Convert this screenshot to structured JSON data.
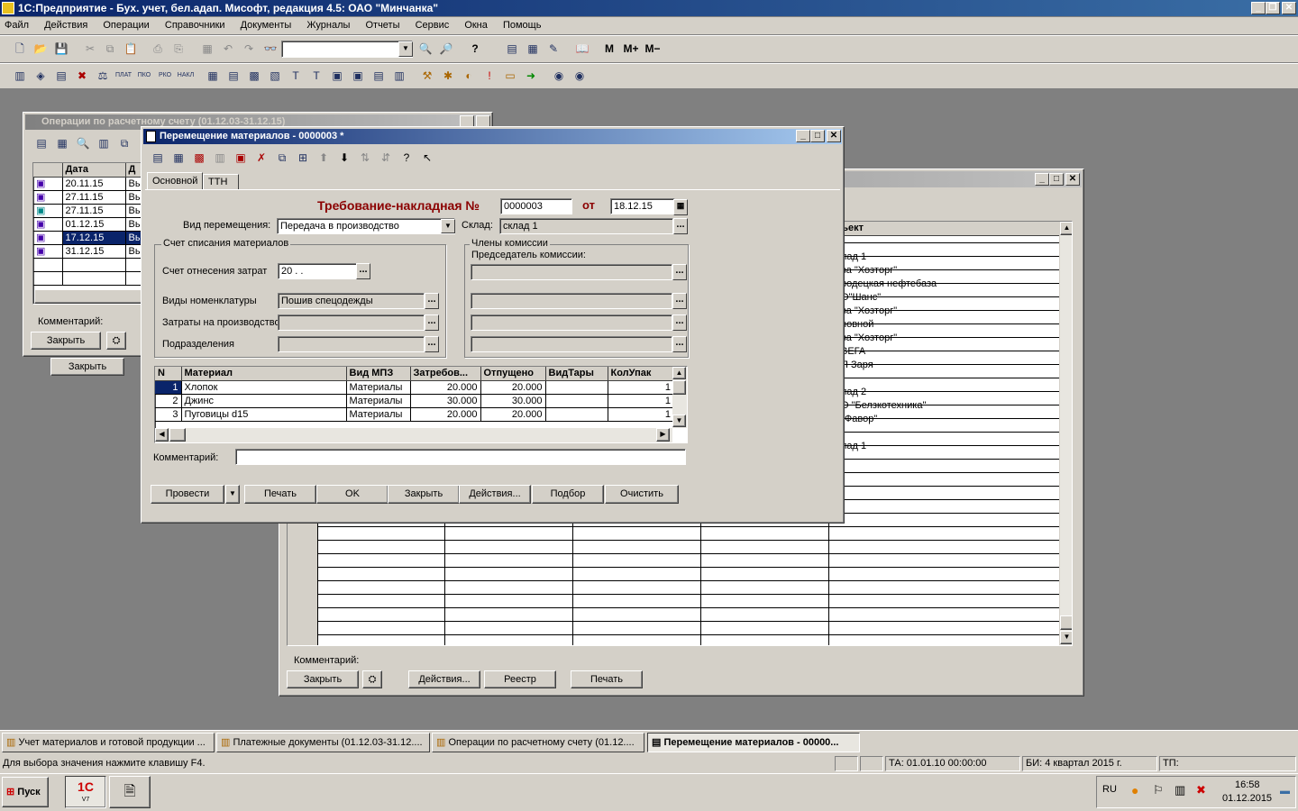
{
  "app": {
    "title": "1С:Предприятие - Бух. учет, бел.адап. Мисофт, редакция 4.5: ОАО \"Минчанка\""
  },
  "menu": [
    "Файл",
    "Действия",
    "Операции",
    "Справочники",
    "Документы",
    "Журналы",
    "Отчеты",
    "Сервис",
    "Окна",
    "Помощь"
  ],
  "toolbar": {
    "m": "M",
    "mplus": "M+",
    "mminus": "M−",
    "plat": "ПЛАТ",
    "pko": "ПКО",
    "rko": "РКО",
    "nakl": "НАКЛ"
  },
  "back_window": {
    "title": "Операции по расчетному счету (01.12.03-31.12.15)",
    "headers": [
      "",
      "Дата",
      "Д"
    ],
    "rows": [
      [
        "20.11.15",
        "Вы"
      ],
      [
        "27.11.15",
        "Вы"
      ],
      [
        "27.11.15",
        "Вы"
      ],
      [
        "01.12.15",
        "Вы"
      ],
      [
        "17.12.15",
        "Вы"
      ],
      [
        "31.12.15",
        "Вы"
      ]
    ],
    "comment_label": "Комментарий:",
    "close": "Закрыть",
    "close2": "Закрыть"
  },
  "right_window": {
    "col_header": "ъект",
    "objects": [
      "",
      "лад 1",
      "ва \"Хозторг\"",
      "родецкая нефтебаза",
      "О\"Шанс\"",
      "ва \"Хозторг\"",
      "новной",
      "ва \"Хозторг\"",
      "ВЕГА",
      "П Заря",
      "",
      "лад 2",
      "О \"Белзкотехника\"",
      "\"Фавор\"",
      "",
      "лад 1"
    ],
    "comment_label": "Комментарий:",
    "close": "Закрыть",
    "actions": "Действия...",
    "registry": "Реестр",
    "print": "Печать"
  },
  "dialog": {
    "title": "Перемещение материалов - 0000003 *",
    "tabs": [
      "Основной",
      "ТТН"
    ],
    "heading": "Требование-накладная №",
    "doc_number": "0000003",
    "from": "от",
    "date": "18.12.15",
    "move_type_label": "Вид перемещения:",
    "move_type": "Передача в производство",
    "warehouse_label": "Склад:",
    "warehouse": "склад 1",
    "writeoff_group": "Счет списания материалов",
    "cost_account_label": "Счет отнесения затрат",
    "cost_account": "20 . .",
    "nomen_label": "Виды номенклатуры",
    "nomen": "Пошив спецодежды",
    "prod_costs_label": "Затраты на производство",
    "prod_costs": "",
    "divisions_label": "Подразделения",
    "divisions": "",
    "commission_group": "Члены комиссии",
    "chairman_label": "Председатель комиссии:",
    "columns": [
      "N",
      "Материал",
      "Вид МПЗ",
      "Затребов...",
      "Отпущено",
      "ВидТары",
      "КолУпак"
    ],
    "rows": [
      {
        "n": "1",
        "material": "Хлопок",
        "type": "Материалы",
        "req": "20.000",
        "rel": "20.000",
        "tara": "",
        "qty": "1"
      },
      {
        "n": "2",
        "material": "Джинс",
        "type": "Материалы",
        "req": "30.000",
        "rel": "30.000",
        "tara": "",
        "qty": "1"
      },
      {
        "n": "3",
        "material": "Пуговицы d15",
        "type": "Материалы",
        "req": "20.000",
        "rel": "20.000",
        "tara": "",
        "qty": "1"
      }
    ],
    "comment_label": "Комментарий:",
    "comment": "",
    "buttons": {
      "post": "Провести",
      "print": "Печать",
      "ok": "OK",
      "close": "Закрыть",
      "actions": "Действия...",
      "selection": "Подбор",
      "clear": "Очистить"
    }
  },
  "taskbar_windows": [
    "Учет материалов и готовой продукции ...",
    "Платежные документы (01.12.03-31.12....",
    "Операции по расчетному счету (01.12....",
    "Перемещение материалов - 00000..."
  ],
  "status": {
    "hint": "Для выбора значения нажмите клавишу F4.",
    "ta": "ТА: 01.01.10  00:00:00",
    "bi": "БИ: 4 квартал 2015 г.",
    "tp": "ТП:"
  },
  "os_taskbar": {
    "start": "Пуск",
    "lang": "RU",
    "time": "16:58",
    "date": "01.12.2015",
    "app_label": "V7"
  }
}
